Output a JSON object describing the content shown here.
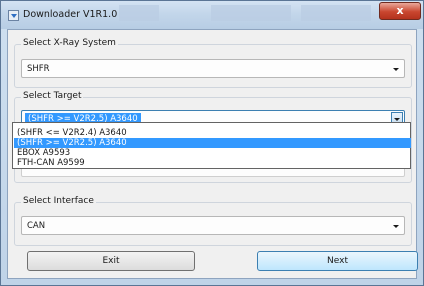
{
  "window": {
    "title": "Downloader V1R1.0",
    "close_glyph": "x"
  },
  "xray": {
    "label": "Select X-Ray System",
    "value": "SHFR"
  },
  "target": {
    "label": "Select Target",
    "value": "(SHFR >= V2R2.5) A3640",
    "options": [
      "(SHFR <= V2R2.4) A3640",
      "(SHFR >= V2R2.5) A3640",
      "EBOX A9593",
      "FTH-CAN A9599"
    ]
  },
  "interface": {
    "label": "Select Interface",
    "value": "CAN"
  },
  "buttons": {
    "exit": "Exit",
    "next": "Next"
  },
  "icons": {
    "app": "download-icon",
    "dropdown": "chevron-down-icon"
  }
}
